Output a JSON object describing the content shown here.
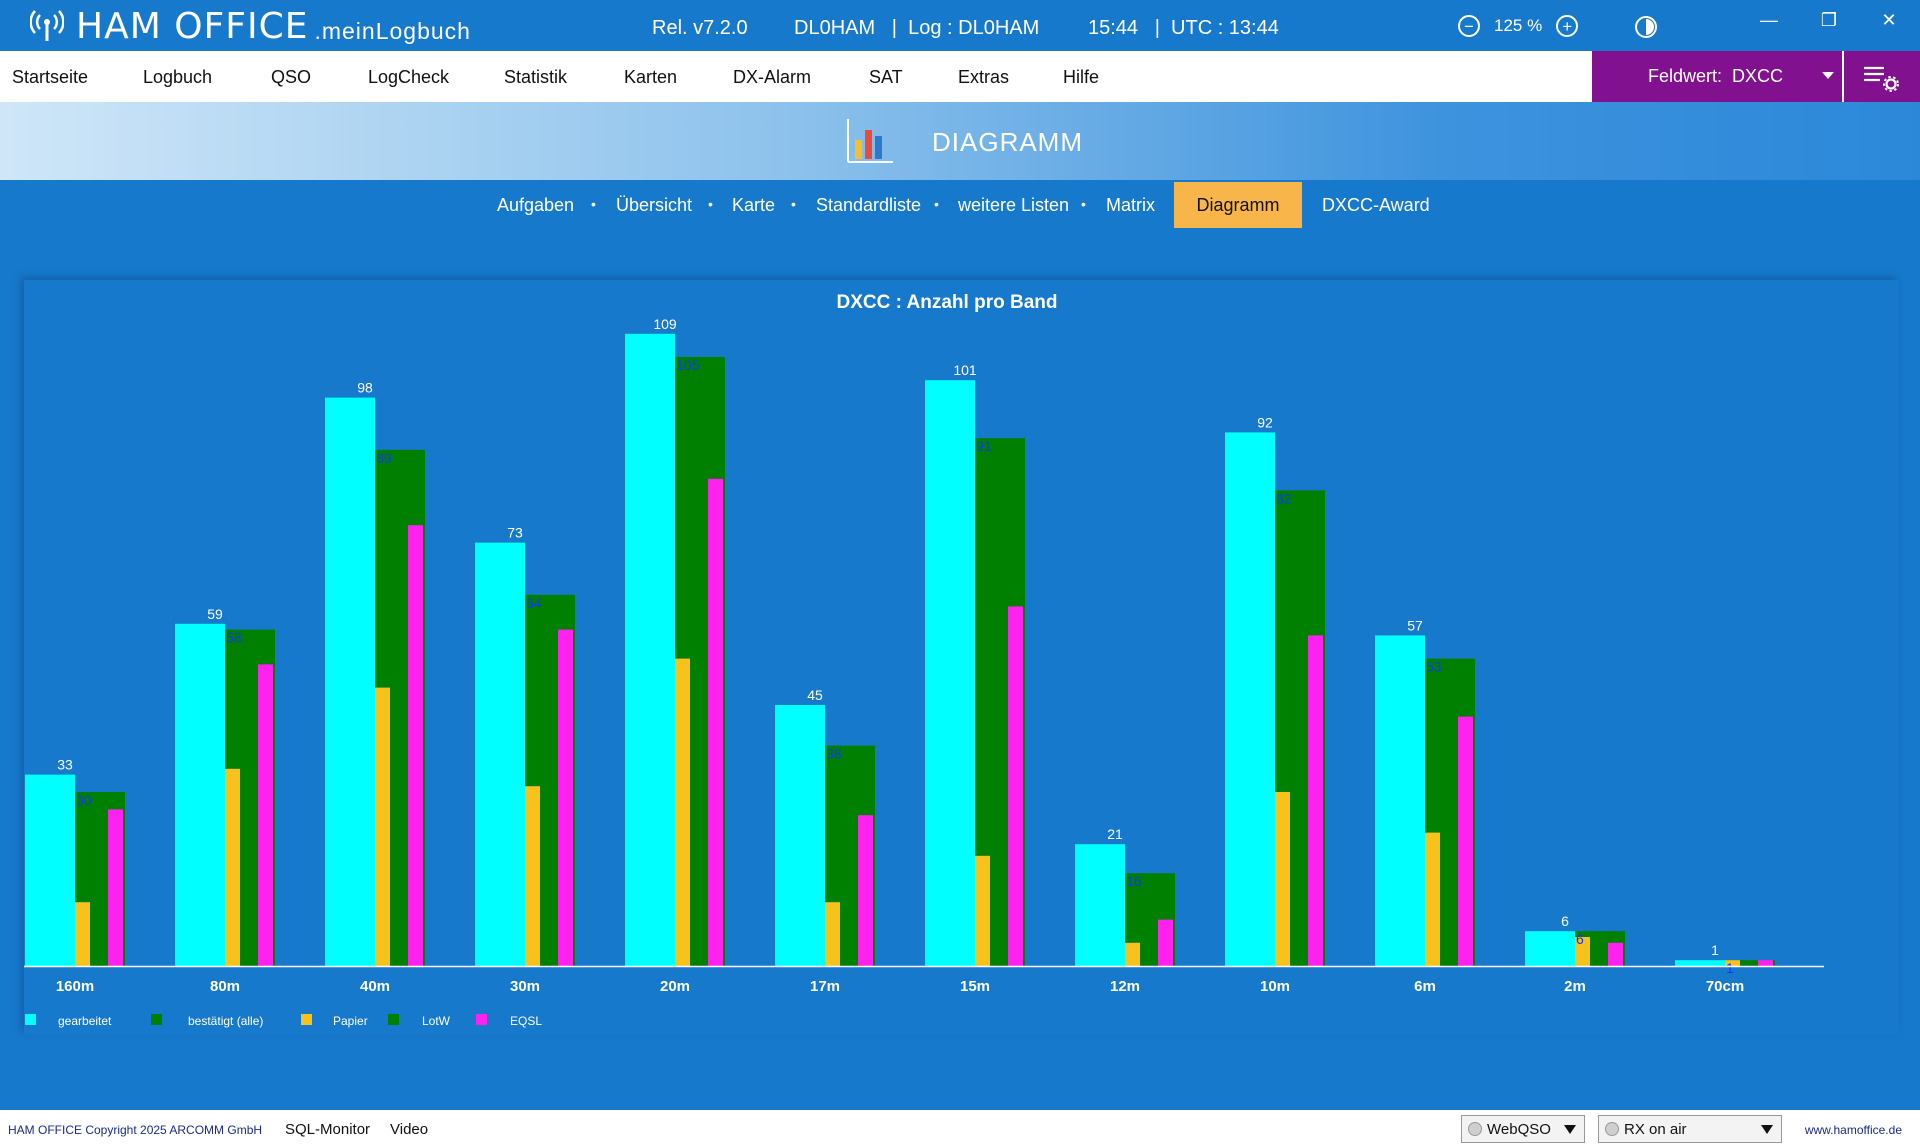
{
  "app": {
    "brand": "HAM OFFICE",
    "brand_sub": ".meinLogbuch",
    "release": "Rel. v7.2.0",
    "callsign_info": "DL0HAM   |  Log : DL0HAM",
    "time_info": "15:44   |  UTC : 13:44",
    "zoom": "125 %"
  },
  "menu": {
    "items": [
      "Startseite",
      "Logbuch",
      "QSO",
      "LogCheck",
      "Statistik",
      "Karten",
      "DX-Alarm",
      "SAT",
      "Extras",
      "Hilfe"
    ],
    "feldwert": "Feldwert:  DXCC"
  },
  "section": {
    "title": "DIAGRAMM"
  },
  "subnav": {
    "items": [
      "Aufgaben",
      "Übersicht",
      "Karte",
      "Standardliste",
      "weitere Listen",
      "Matrix"
    ],
    "active": "Diagramm",
    "last": "DXCC-Award"
  },
  "chart_data": {
    "type": "bar",
    "title": "DXCC : Anzahl pro Band",
    "categories": [
      "160m",
      "80m",
      "40m",
      "30m",
      "20m",
      "17m",
      "15m",
      "12m",
      "10m",
      "6m",
      "2m",
      "70cm"
    ],
    "series": [
      {
        "name": "gearbeitet",
        "color": "#00ffff",
        "values": [
          33,
          59,
          98,
          73,
          109,
          45,
          101,
          21,
          92,
          57,
          6,
          1
        ]
      },
      {
        "name": "bestätigt (alle)",
        "color": "#008000",
        "values": [
          30,
          58,
          89,
          64,
          105,
          38,
          91,
          16,
          82,
          53,
          6,
          1
        ]
      },
      {
        "name": "Papier",
        "color": "#f8c21c",
        "values": [
          11,
          34,
          48,
          31,
          53,
          11,
          19,
          4,
          30,
          23,
          5,
          1
        ]
      },
      {
        "name": "LotW",
        "color": "#008000",
        "values": [],
        "legend_only": true
      },
      {
        "name": "EQSL",
        "color": "#ff22ee",
        "values": [
          27,
          52,
          76,
          58,
          84,
          26,
          62,
          8,
          57,
          43,
          4,
          1
        ]
      }
    ],
    "ylim": [
      0,
      115
    ],
    "grid": false,
    "legend": "bottom-left"
  },
  "status": {
    "copyright": "HAM OFFICE Copyright 2025 ARCOMM GmbH",
    "links": [
      "SQL-Monitor",
      "Video"
    ],
    "webqso": "WebQSO",
    "rx": "RX on air",
    "website": "www.hamoffice.de"
  }
}
